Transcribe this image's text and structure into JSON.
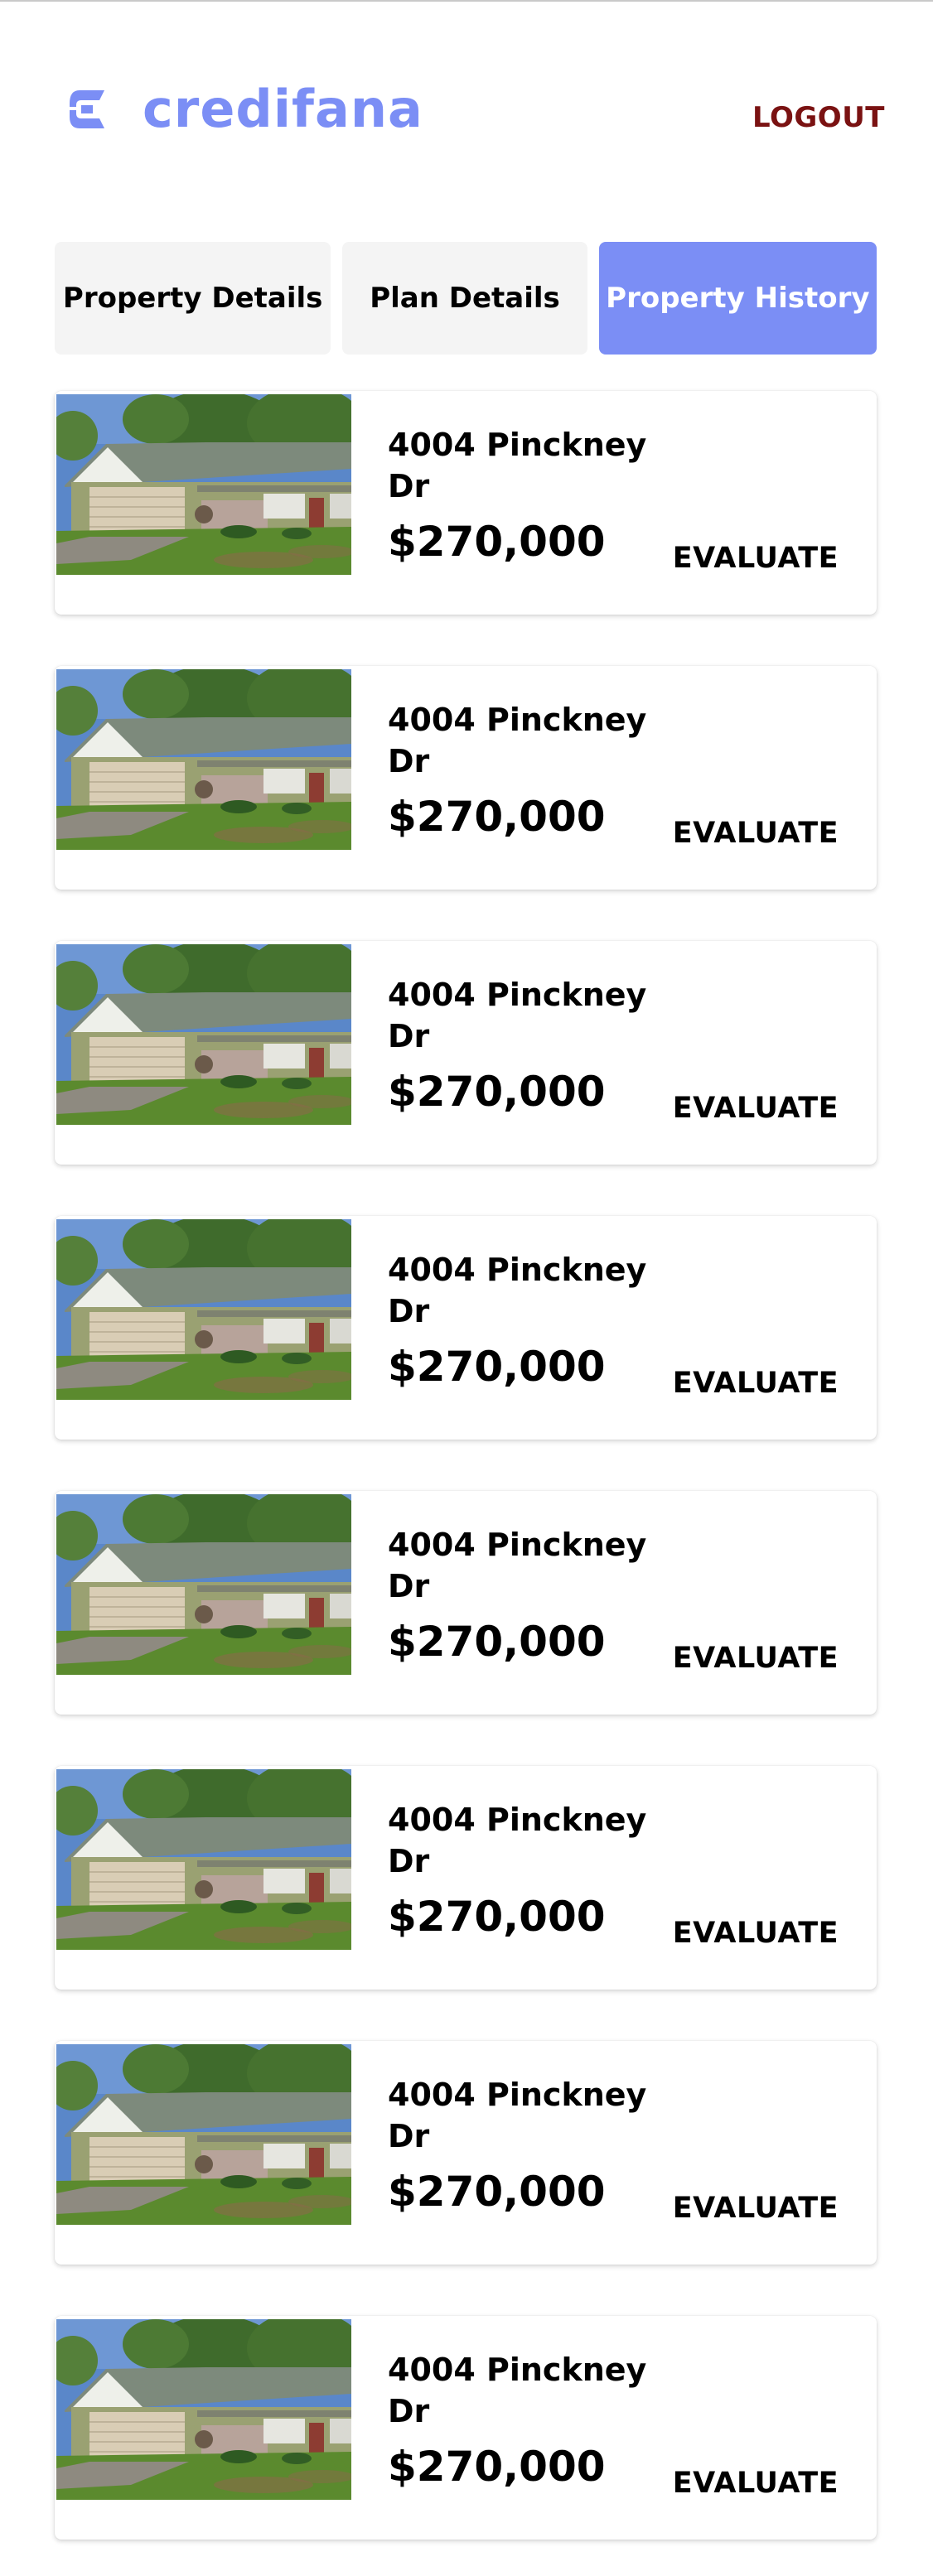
{
  "brand": {
    "name": "credifana",
    "color": "#7b8ef5"
  },
  "header": {
    "logout_label": "LOGOUT",
    "logout_color": "#7a1212"
  },
  "tabs": [
    {
      "label": "Property Details",
      "active": false
    },
    {
      "label": "Plan Details",
      "active": false
    },
    {
      "label": "Property History",
      "active": true
    }
  ],
  "properties": [
    {
      "address": "4004 Pinckney Dr",
      "price": "$270,000",
      "action": "EVALUATE"
    },
    {
      "address": "4004 Pinckney Dr",
      "price": "$270,000",
      "action": "EVALUATE"
    },
    {
      "address": "4004 Pinckney Dr",
      "price": "$270,000",
      "action": "EVALUATE"
    },
    {
      "address": "4004 Pinckney Dr",
      "price": "$270,000",
      "action": "EVALUATE"
    },
    {
      "address": "4004 Pinckney Dr",
      "price": "$270,000",
      "action": "EVALUATE"
    },
    {
      "address": "4004 Pinckney Dr",
      "price": "$270,000",
      "action": "EVALUATE"
    },
    {
      "address": "4004 Pinckney Dr",
      "price": "$270,000",
      "action": "EVALUATE"
    },
    {
      "address": "4004 Pinckney Dr",
      "price": "$270,000",
      "action": "EVALUATE"
    }
  ]
}
